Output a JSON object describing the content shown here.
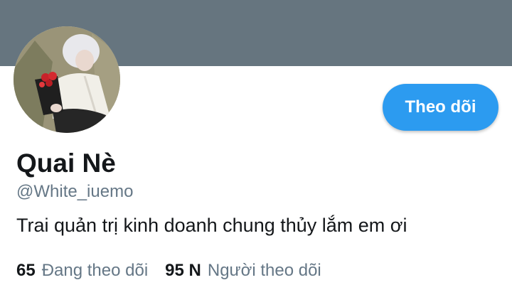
{
  "profile": {
    "name": "Quai Nè",
    "handle": "@White_iuemo",
    "bio": "Trai quản trị kinh doanh chung thủy lắm em ơi",
    "follow_button_label": "Theo dõi"
  },
  "stats": {
    "following_count": "65",
    "following_label": "Đang theo dõi",
    "followers_count": "95 N",
    "followers_label": "Người theo dõi"
  },
  "colors": {
    "banner": "#66757f",
    "accent": "#2c9bf0",
    "text_primary": "#14171a",
    "text_secondary": "#657786"
  }
}
